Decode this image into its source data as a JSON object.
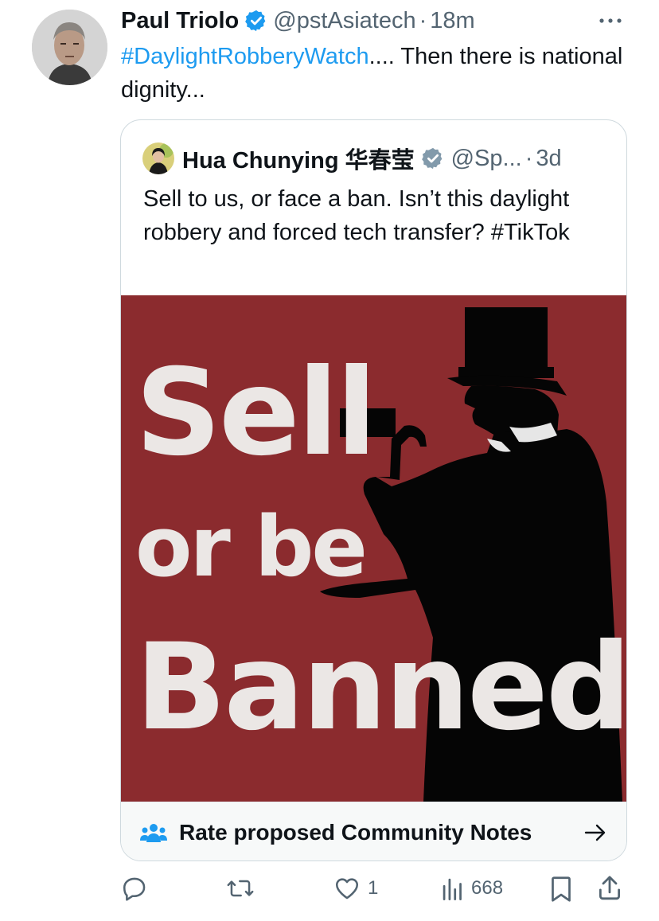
{
  "tweet": {
    "author_name": "Paul Triolo",
    "handle": "@pstAsiatech",
    "separator": "·",
    "time": "18m",
    "hashtag": "#DaylightRobberyWatch",
    "text_rest": ".... Then there is national dignity..."
  },
  "quote": {
    "author_name": "Hua Chunying 华春莹",
    "handle": "@Sp...",
    "separator": "·",
    "time": "3d",
    "text": "Sell to us, or face a ban. Isn’t this daylight robbery and forced tech transfer? #TikTok",
    "image": {
      "line1": "Sell",
      "line2": "or be",
      "line3": "Banned",
      "background": "#8b2b2e",
      "text_color": "#ebe7e5"
    }
  },
  "community_notes": {
    "label": "Rate proposed Community Notes"
  },
  "actions": {
    "reply_count": "",
    "retweet_count": "",
    "like_count": "1",
    "views_count": "668"
  },
  "colors": {
    "link": "#1d9bf0",
    "secondary_text": "#536471",
    "verified": "#1d9bf0",
    "verified_gray": "#829aab",
    "border": "#cfd9de"
  }
}
